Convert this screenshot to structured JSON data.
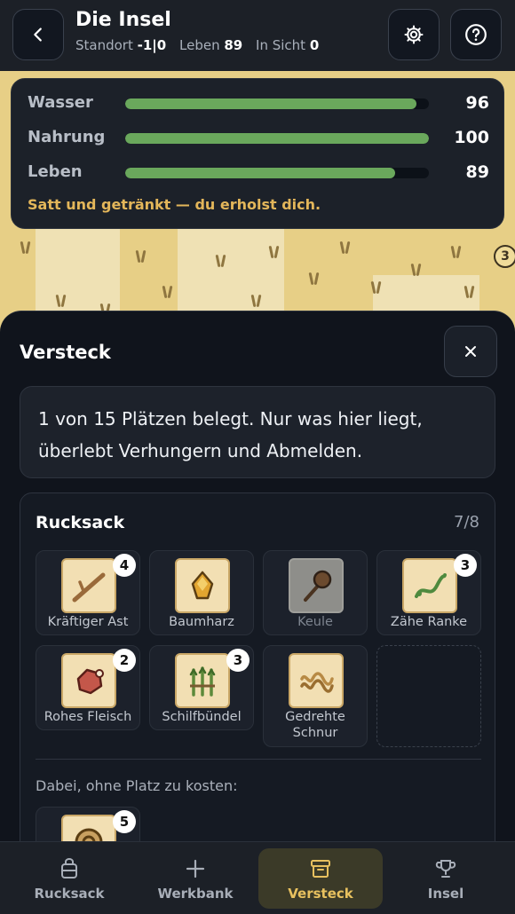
{
  "header": {
    "title": "Die Insel",
    "location_label": "Standort",
    "location_value": "-1|0",
    "life_label": "Leben",
    "life_value": "89",
    "visible_label": "In Sicht",
    "visible_value": "0",
    "back_icon": "chevron-left-icon",
    "settings_icon": "gear-icon",
    "help_icon": "help-circle-icon"
  },
  "map": {
    "badges": [
      "3"
    ]
  },
  "stats": {
    "rows": [
      {
        "label": "Wasser",
        "value": "96",
        "fill": 0.96
      },
      {
        "label": "Nahrung",
        "value": "100",
        "fill": 1.0
      },
      {
        "label": "Leben",
        "value": "89",
        "fill": 0.89
      }
    ],
    "message": "Satt und getränkt — du erholst dich.",
    "bar_color": "#6aa85c",
    "message_color": "#e3b65a"
  },
  "sheet": {
    "title": "Versteck",
    "info": "1 von 15 Plätzen belegt. Nur was hier liegt, überlebt Verhungern und Abmelden.",
    "backpack": {
      "title": "Rucksack",
      "count": "7/8",
      "items": [
        {
          "label": "Kräftiger Ast",
          "qty": "4",
          "icon": "branch-icon"
        },
        {
          "label": "Baumharz",
          "qty": "",
          "icon": "resin-icon"
        },
        {
          "label": "Keule",
          "qty": "",
          "icon": "club-icon",
          "equipped": true
        },
        {
          "label": "Zähe Ranke",
          "qty": "3",
          "icon": "vine-icon"
        },
        {
          "label": "Rohes Fleisch",
          "qty": "2",
          "icon": "raw-meat-icon"
        },
        {
          "label": "Schilfbündel",
          "qty": "3",
          "icon": "reed-bundle-icon"
        },
        {
          "label": "Gedrehte Schnur",
          "qty": "",
          "icon": "twine-icon"
        }
      ],
      "free_label": "Dabei, ohne Platz zu kosten:",
      "free_items": [
        {
          "qty": "5",
          "icon": "coin-icon"
        }
      ]
    }
  },
  "nav": {
    "items": [
      {
        "label": "Rucksack",
        "icon": "backpack-icon"
      },
      {
        "label": "Werkbank",
        "icon": "plus-icon"
      },
      {
        "label": "Versteck",
        "icon": "chest-icon",
        "active": true
      },
      {
        "label": "Insel",
        "icon": "trophy-icon"
      }
    ],
    "accent": "#e8c15f"
  }
}
